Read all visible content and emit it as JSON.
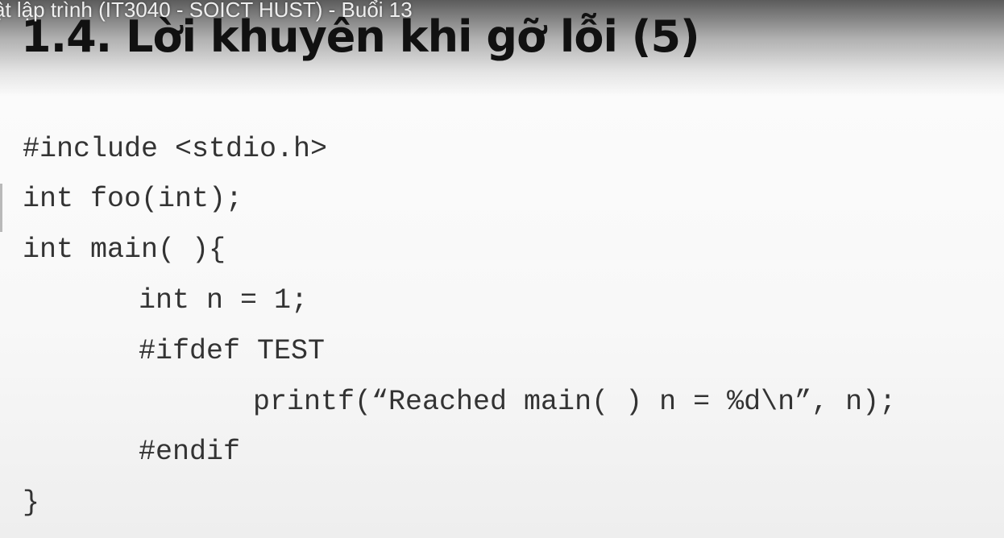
{
  "video": {
    "title": "ật lập trình (IT3040 - SOICT HUST) - Buổi 13"
  },
  "slide": {
    "title": "1.4. Lời khuyên khi gỡ lỗi (5)",
    "code_lines": [
      "#include <stdio.h>",
      "int foo(int);",
      "int main( ){",
      "int n = 1;",
      "#ifdef TEST",
      "printf(“Reached main( ) n = %d\\n”, n);",
      "#endif",
      "}"
    ]
  }
}
